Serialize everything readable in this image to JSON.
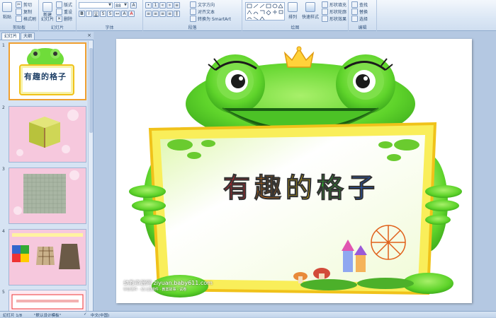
{
  "ribbon": {
    "clipboard": {
      "group_label": "剪贴板",
      "paste": "粘贴",
      "cut": "剪切",
      "copy": "复制",
      "format_painter": "格式刷"
    },
    "slides": {
      "group_label": "幻灯片",
      "new_slide": "新建\n幻灯片",
      "layout": "版式",
      "reset": "重设",
      "delete": "删除"
    },
    "font": {
      "group_label": "字体",
      "font_size": "88"
    },
    "paragraph": {
      "group_label": "段落",
      "text_direction": "文字方向",
      "align_text": "对齐文本",
      "smartart": "转换为 SmartArt"
    },
    "drawing": {
      "group_label": "绘图",
      "arrange": "排列",
      "quick_styles": "快速样式",
      "shape_fill": "形状填充",
      "shape_outline": "形状轮廓",
      "shape_effects": "形状效果"
    },
    "editing": {
      "group_label": "编辑",
      "find": "查找",
      "replace": "替换",
      "select": "选择"
    }
  },
  "left_panel": {
    "tab_slides": "幻灯片",
    "tab_outline": "大纲",
    "thumbnails": [
      {
        "number": "1",
        "title": "有趣的格子"
      },
      {
        "number": "2",
        "title": ""
      },
      {
        "number": "3",
        "title": ""
      },
      {
        "number": "4",
        "title": ""
      },
      {
        "number": "5",
        "title": ""
      }
    ]
  },
  "slide": {
    "title_chars": [
      "有",
      "趣",
      "的",
      "格",
      "子"
    ],
    "title_colors": [
      "#e8202a",
      "#ff7a00",
      "#f2c400",
      "#2db52d",
      "#1f5fd6"
    ],
    "watermark": "幼教资源网 ziyuan.baby611.com",
    "watermark_sub": "学前课件 · 幼儿园课件 · 教案故事 · 试卷"
  },
  "statusbar": {
    "slide_count": "幻灯片 1/8",
    "theme": "\"默认设计模板\"",
    "language": "中文(中国)"
  }
}
